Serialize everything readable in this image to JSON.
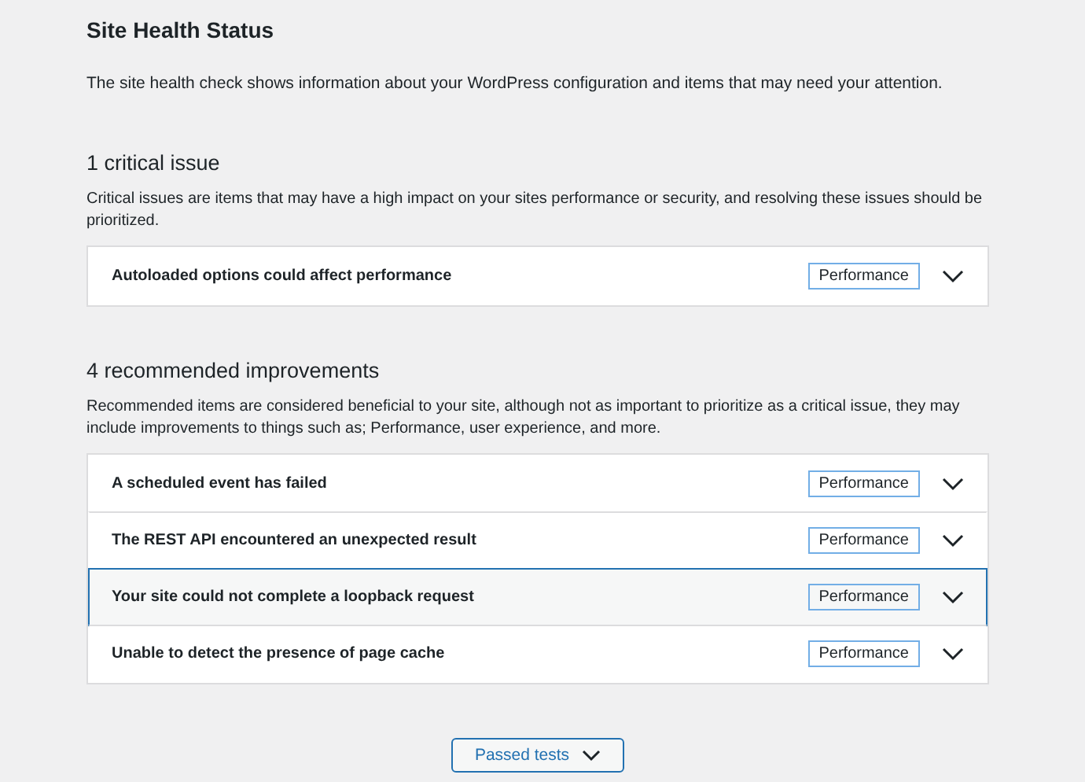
{
  "title": "Site Health Status",
  "description": "The site health check shows information about your WordPress configuration and items that may need your attention.",
  "sections": [
    {
      "heading": "1 critical issue",
      "description": "Critical issues are items that may have a high impact on your sites performance or security, and resolving these issues should be prioritized.",
      "items": [
        {
          "label": "Autoloaded options could affect performance",
          "badge": "Performance",
          "selected": false
        }
      ]
    },
    {
      "heading": "4 recommended improvements",
      "description": "Recommended items are considered beneficial to your site, although not as important to prioritize as a critical issue, they may include improvements to things such as; Performance, user experience, and more.",
      "items": [
        {
          "label": "A scheduled event has failed",
          "badge": "Performance",
          "selected": false
        },
        {
          "label": "The REST API encountered an unexpected result",
          "badge": "Performance",
          "selected": false
        },
        {
          "label": "Your site could not complete a loopback request",
          "badge": "Performance",
          "selected": true
        },
        {
          "label": "Unable to detect the presence of page cache",
          "badge": "Performance",
          "selected": false
        }
      ]
    }
  ],
  "passed_button": "Passed tests"
}
